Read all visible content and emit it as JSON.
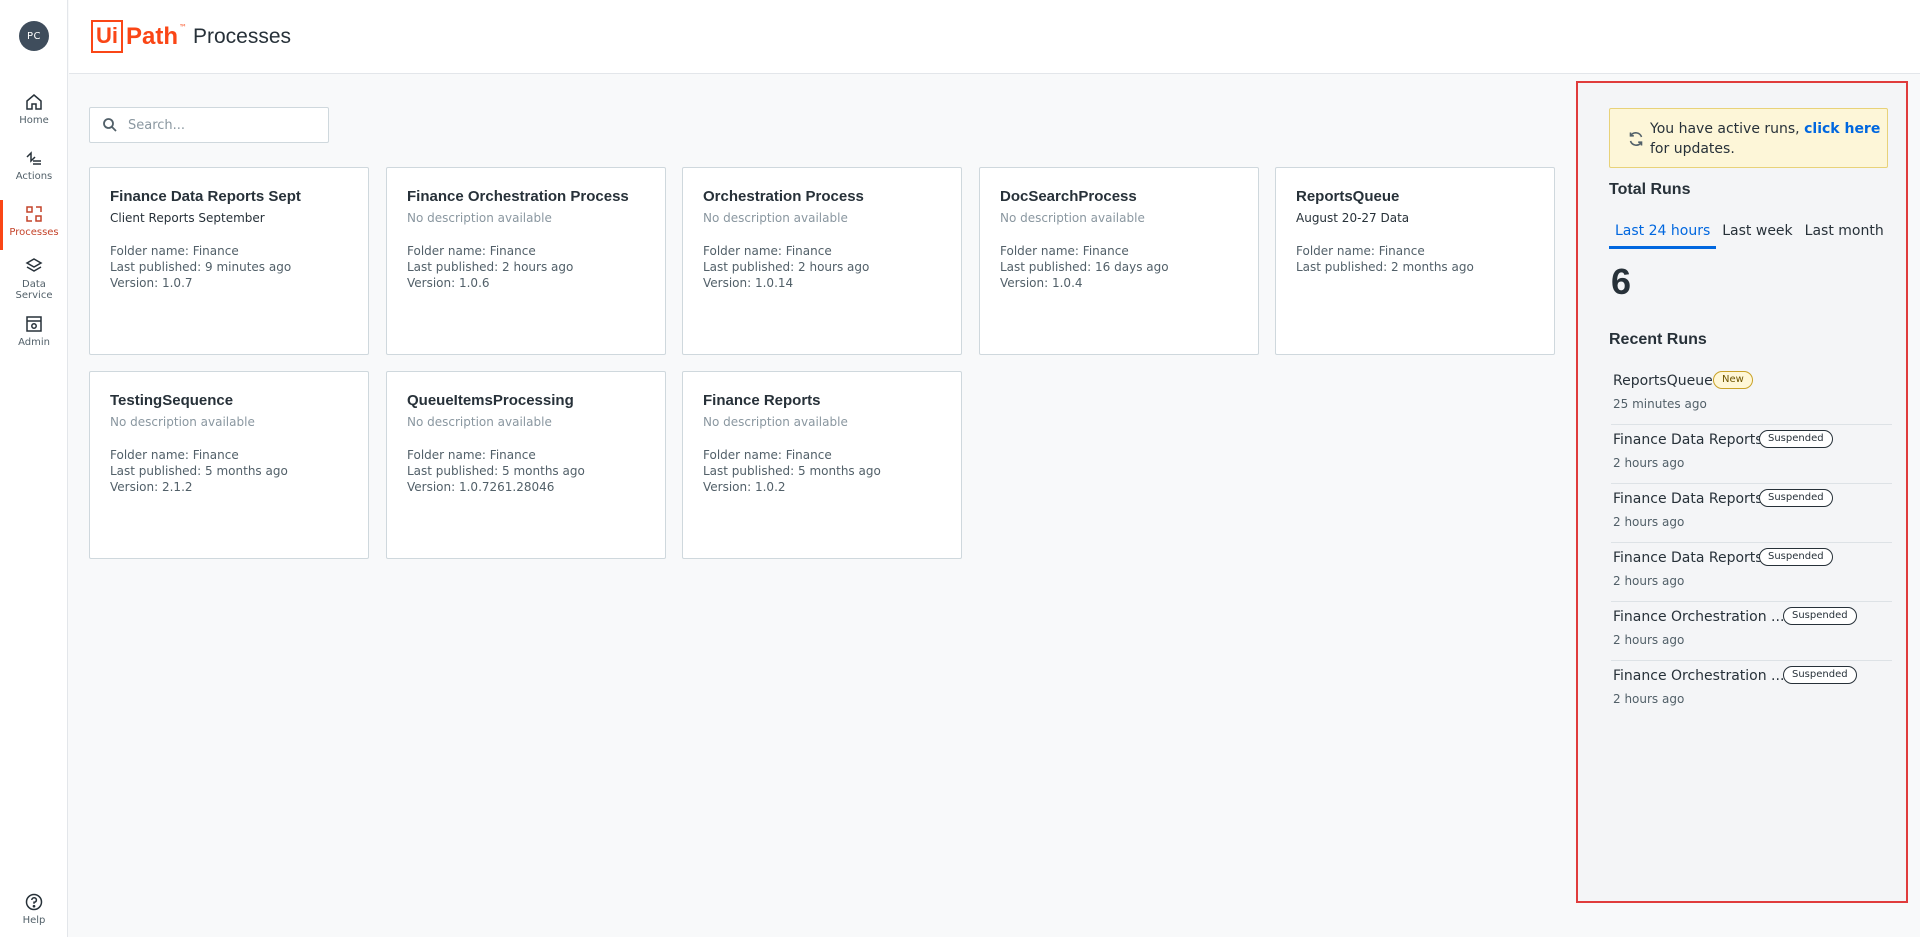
{
  "app": {
    "avatar_initials": "PC",
    "logo_text": "Ui",
    "logo_text2": "Path",
    "logo_tm": "™",
    "page_title": "Processes",
    "accent": "#fa4616"
  },
  "rail": {
    "items": [
      {
        "label": "Home",
        "icon": "home-icon"
      },
      {
        "label": "Actions",
        "icon": "actions-icon"
      },
      {
        "label": "Processes",
        "icon": "processes-icon"
      },
      {
        "label": "Data Service",
        "icon": "data-service-icon"
      },
      {
        "label": "Admin",
        "icon": "admin-icon"
      }
    ],
    "help": {
      "label": "Help",
      "icon": "help-icon"
    }
  },
  "search": {
    "placeholder": "Search..."
  },
  "processes": [
    {
      "title": "Finance Data Reports Sept",
      "description": "Client Reports September",
      "folder": "Folder name: Finance",
      "published": "Last published: 9 minutes ago",
      "version": "Version: 1.0.7"
    },
    {
      "title": "Finance Orchestration Process",
      "description": "No description available",
      "folder": "Folder name: Finance",
      "published": "Last published: 2 hours ago",
      "version": "Version: 1.0.6"
    },
    {
      "title": "Orchestration Process",
      "description": "No description available",
      "folder": "Folder name: Finance",
      "published": "Last published: 2 hours ago",
      "version": "Version: 1.0.14"
    },
    {
      "title": "DocSearchProcess",
      "description": "No description available",
      "folder": "Folder name: Finance",
      "published": "Last published: 16 days ago",
      "version": "Version: 1.0.4"
    },
    {
      "title": "ReportsQueue",
      "description": "August 20-27 Data",
      "folder": "Folder name: Finance",
      "published": "Last published: 2 months ago",
      "version": ""
    },
    {
      "title": "TestingSequence",
      "description": "No description available",
      "folder": "Folder name: Finance",
      "published": "Last published: 5 months ago",
      "version": "Version: 2.1.2"
    },
    {
      "title": "QueueItemsProcessing",
      "description": "No description available",
      "folder": "Folder name: Finance",
      "published": "Last published: 5 months ago",
      "version": "Version: 1.0.7261.28046"
    },
    {
      "title": "Finance Reports",
      "description": "No description available",
      "folder": "Folder name: Finance",
      "published": "Last published: 5 months ago",
      "version": "Version: 1.0.2"
    }
  ],
  "panel": {
    "alert": {
      "prefix": "You have active runs, ",
      "link": "click here",
      "suffix": " for updates."
    },
    "total_runs_title": "Total Runs",
    "tabs": [
      {
        "label": "Last 24 hours",
        "active": true
      },
      {
        "label": "Last week",
        "active": false
      },
      {
        "label": "Last month",
        "active": false
      }
    ],
    "total_count": "6",
    "recent_runs_title": "Recent Runs",
    "runs": [
      {
        "name": "ReportsQueue",
        "status": "New",
        "time": "25 minutes ago"
      },
      {
        "name": "Finance Data Reports",
        "status": "Suspended",
        "time": "2 hours ago"
      },
      {
        "name": "Finance Data Reports",
        "status": "Suspended",
        "time": "2 hours ago"
      },
      {
        "name": "Finance Data Reports",
        "status": "Suspended",
        "time": "2 hours ago"
      },
      {
        "name": "Finance Orchestration ...",
        "status": "Suspended",
        "time": "2 hours ago"
      },
      {
        "name": "Finance Orchestration ...",
        "status": "Suspended",
        "time": "2 hours ago"
      }
    ]
  }
}
